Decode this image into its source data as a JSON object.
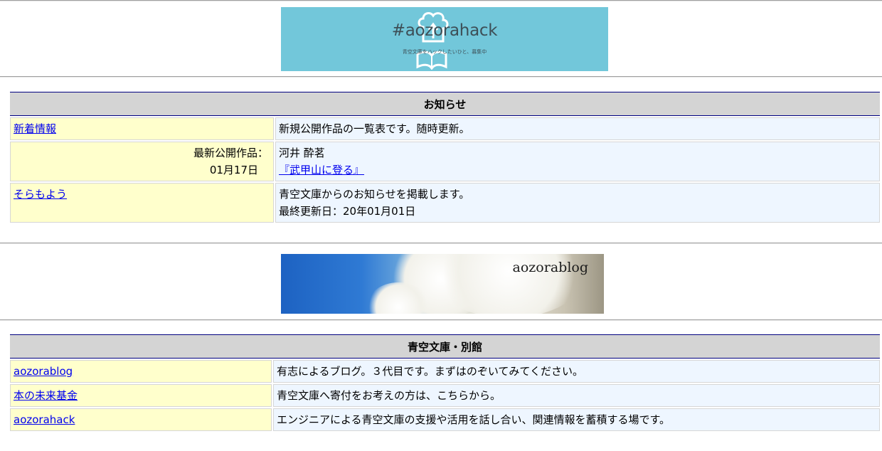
{
  "hack_banner": {
    "title": "#aozorahack",
    "subtitle": "青空文庫をハックしたいひと、募集中",
    "icon": "book-cloud-icon"
  },
  "notice": {
    "header": "お知らせ",
    "rows": [
      {
        "left_link": "新着情報",
        "right_text": "新規公開作品の一覧表です。随時更新。"
      },
      {
        "left_label": "最新公開作品：",
        "left_date": "01月17日",
        "right_author": "河井 酔茗",
        "right_link": "『武甲山に登る』"
      },
      {
        "left_link": "そらもよう",
        "right_text": "青空文庫からのお知らせを掲載します。",
        "right_text2": "最終更新日：20年01月01日"
      }
    ]
  },
  "blog_banner": {
    "title": "aozorablog"
  },
  "annex": {
    "header": "青空文庫・別館",
    "rows": [
      {
        "left_link": "aozorablog",
        "right_text": "有志によるブログ。３代目です。まずはのぞいてみてください。"
      },
      {
        "left_link": "本の未来基金",
        "right_text": "青空文庫へ寄付をお考えの方は、こちらから。"
      },
      {
        "left_link": "aozorahack",
        "right_text": "エンジニアによる青空文庫の支援や活用を話し合い、関連情報を蓄積する場です。"
      }
    ]
  },
  "colors": {
    "header_bg": "#d4d4d4",
    "header_rule": "#000080",
    "left_cell_bg": "#ffffcc",
    "right_cell_bg": "#eef6ff",
    "link": "#0000ee",
    "hack_banner_bg": "#72c7da"
  }
}
